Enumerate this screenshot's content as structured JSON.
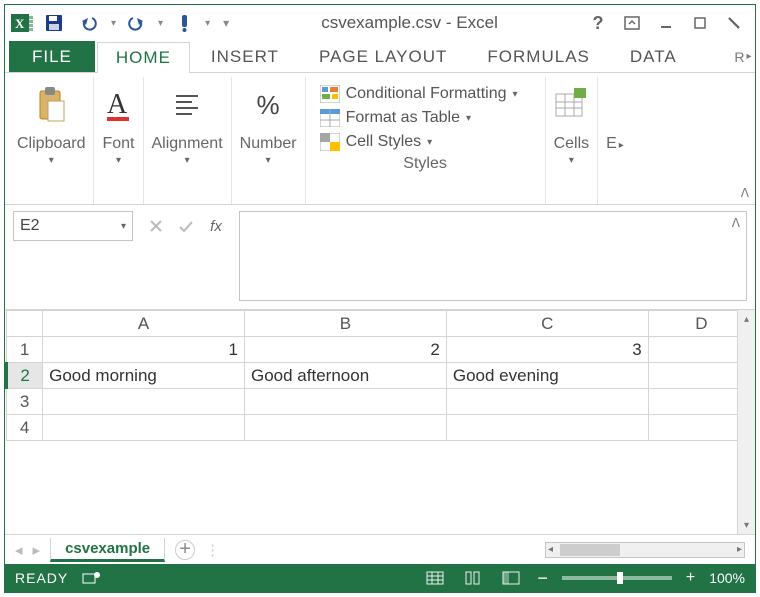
{
  "title": "csvexample.csv - Excel",
  "tabs": {
    "file": "FILE",
    "home": "HOME",
    "insert": "INSERT",
    "page_layout": "PAGE LAYOUT",
    "formulas": "FORMULAS",
    "data": "DATA",
    "overflow": "R"
  },
  "ribbon": {
    "clipboard": "Clipboard",
    "font": "Font",
    "alignment": "Alignment",
    "number": "Number",
    "styles_caption": "Styles",
    "cond_fmt": "Conditional Formatting",
    "fmt_table": "Format as Table",
    "cell_styles": "Cell Styles",
    "cells": "Cells",
    "overflow": "E"
  },
  "formula_bar": {
    "namebox": "E2",
    "fx": "fx",
    "value": ""
  },
  "grid": {
    "columns": [
      "A",
      "B",
      "C",
      "D"
    ],
    "rows": [
      "1",
      "2",
      "3",
      "4"
    ],
    "selected_row": "2",
    "cells": {
      "A1": "1",
      "B1": "2",
      "C1": "3",
      "A2": "Good morning",
      "B2": "Good afternoon",
      "C2": "Good evening"
    }
  },
  "sheet_tabs": {
    "active": "csvexample"
  },
  "statusbar": {
    "ready": "READY",
    "zoom": "100%"
  }
}
